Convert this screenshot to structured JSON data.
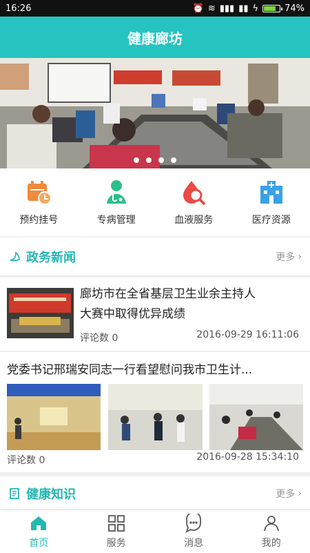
{
  "status": {
    "time": "16:26",
    "battery": "74%",
    "battery_level": 0.74
  },
  "app": {
    "title": "健康廊坊"
  },
  "banner": {
    "active_slide": 1,
    "slides": 4
  },
  "quick_actions": [
    {
      "label": "预约挂号",
      "icon": "calendar-clock-icon",
      "color": "#f08a3c"
    },
    {
      "label": "专病管理",
      "icon": "doctor-icon",
      "color": "#2cbf8b"
    },
    {
      "label": "血液服务",
      "icon": "blood-drop-search-icon",
      "color": "#e84c45"
    },
    {
      "label": "医疗资源",
      "icon": "hospital-icon",
      "color": "#3aa1e5"
    }
  ],
  "news_section": {
    "title": "政务新闻",
    "more": "更多"
  },
  "news": [
    {
      "title_line1": "廊坊市在全省基层卫生业余主持人",
      "title_line2": "大赛中取得优异成绩",
      "comments": "评论数 0",
      "date": "2016-09-29 16:11:06"
    },
    {
      "title": "党委书记邢瑞安同志一行看望慰问我市卫生计...",
      "comments": "评论数 0",
      "date": "2016-09-28 15:34:10"
    }
  ],
  "knowledge_section": {
    "title": "健康知识",
    "more": "更多"
  },
  "tabs": [
    {
      "label": "首页",
      "icon": "home-icon",
      "active": true
    },
    {
      "label": "服务",
      "icon": "grid-icon",
      "active": false
    },
    {
      "label": "消息",
      "icon": "chat-icon",
      "active": false
    },
    {
      "label": "我的",
      "icon": "user-icon",
      "active": false
    }
  ]
}
